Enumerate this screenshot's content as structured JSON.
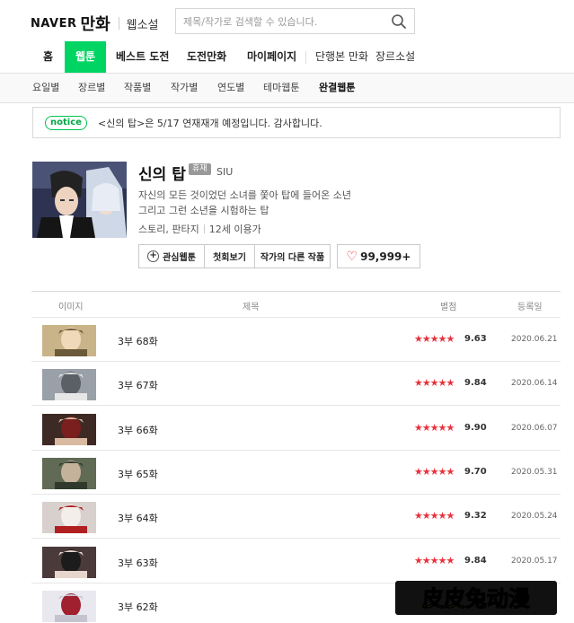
{
  "header": {
    "logo_naver": "NAVER",
    "logo_manhwa": "만화",
    "logo_web": "웹소설",
    "search_placeholder": "제목/작가로 검색할 수 있습니다."
  },
  "nav": {
    "items": [
      "홈",
      "웹툰",
      "베스트 도전",
      "도전만화",
      "마이페이지",
      "단행본 만화",
      "장르소설"
    ],
    "active": "웹툰",
    "accent": "#00d564"
  },
  "subnav": {
    "items": [
      "요일별",
      "장르별",
      "작품별",
      "작가별",
      "연도별",
      "테마웹툰",
      "완결웹툰"
    ],
    "active": "완결웹툰"
  },
  "notice": {
    "badge": "notice",
    "text": "<신의 탑>은 5/17 연재재개 예정입니다. 감사합니다."
  },
  "comic": {
    "title": "신의 탑",
    "badge": "휴재",
    "author": "SIU",
    "desc_line1": "자신의 모든 것이었던 소녀를 쫓아 탑에 들어온 소년",
    "desc_line2": "그리고 그런 소년을 시험하는 탑",
    "genre": "스토리, 판타지",
    "age": "12세 이용가",
    "buttons": {
      "favorite": "관심웹툰",
      "first": "첫회보기",
      "other": "작가의 다른 작품",
      "likes": "99,999+"
    }
  },
  "table": {
    "headers": [
      "이미지",
      "제목",
      "별점",
      "등록일"
    ],
    "rows": [
      {
        "title": "3부 68화",
        "stars": "★★★★★",
        "rating": "9.63",
        "date": "2020.06.21"
      },
      {
        "title": "3부 67화",
        "stars": "★★★★★",
        "rating": "9.84",
        "date": "2020.06.14"
      },
      {
        "title": "3부 66화",
        "stars": "★★★★★",
        "rating": "9.90",
        "date": "2020.06.07"
      },
      {
        "title": "3부 65화",
        "stars": "★★★★★",
        "rating": "9.70",
        "date": "2020.05.31"
      },
      {
        "title": "3부 64화",
        "stars": "★★★★★",
        "rating": "9.32",
        "date": "2020.05.24"
      },
      {
        "title": "3부 63화",
        "stars": "★★★★★",
        "rating": "9.84",
        "date": "2020.05.17"
      },
      {
        "title": "3부 62화",
        "stars": "",
        "rating": "",
        "date": ""
      }
    ]
  },
  "watermark": {
    "text": "皮皮兔动漫"
  }
}
